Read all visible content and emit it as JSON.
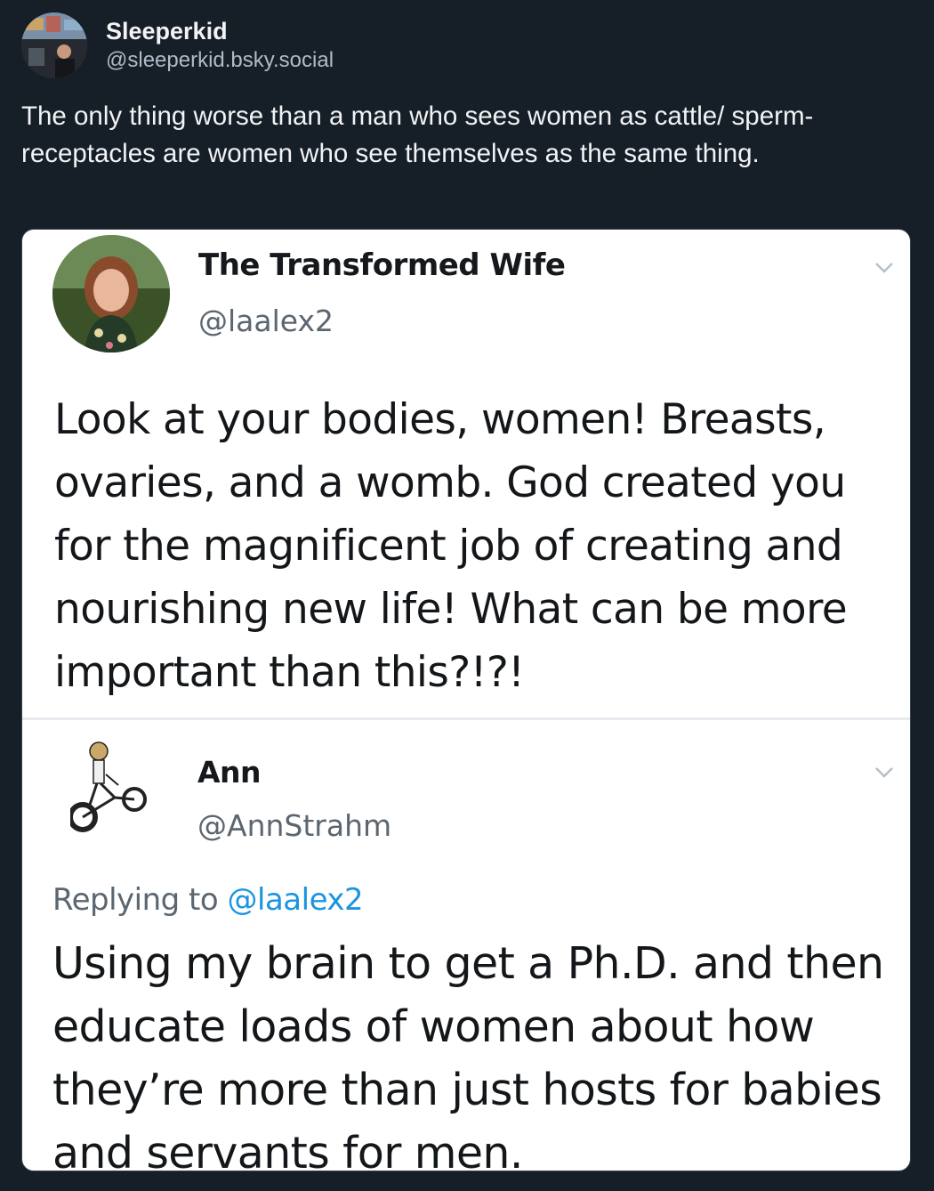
{
  "post": {
    "display_name": "Sleeperkid",
    "handle": "@sleeperkid.bsky.social",
    "text": "The only thing worse than a man who sees women as cattle/ sperm-receptacles are women who see themselves as the same thing."
  },
  "embed": {
    "tweet_1": {
      "name": "The Transformed Wife",
      "handle": "@laalex2",
      "text": "Look at your bodies, women! Breasts, ovaries, and a womb. God created you for the magnificent job of creating and nourishing new life! What can be more important than this?!?!"
    },
    "tweet_2": {
      "name": "Ann",
      "handle": "@AnnStrahm",
      "replying_prefix": "Replying to",
      "replying_mention": "@laalex2",
      "text": "Using my brain to get a Ph.D. and then educate loads of women about how they’re more than just hosts for babies and servants for men."
    }
  },
  "colors": {
    "background": "#161e27",
    "mention": "#1b95e0"
  },
  "icons": {
    "menu": "chevron-down-icon"
  }
}
